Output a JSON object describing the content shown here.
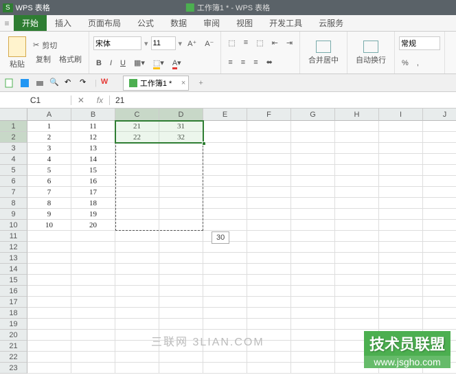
{
  "titlebar": {
    "app": "WPS 表格",
    "doc": "工作簿1 * - WPS 表格"
  },
  "menu": {
    "wps": "W",
    "tabs": [
      "开始",
      "插入",
      "页面布局",
      "公式",
      "数据",
      "审阅",
      "视图",
      "开发工具",
      "云服务"
    ],
    "active": 0
  },
  "ribbon": {
    "paste": "粘贴",
    "cut": "剪切",
    "copy": "复制",
    "format_painter": "格式刷",
    "font_name": "宋体",
    "font_size": "11",
    "bold": "B",
    "italic": "I",
    "underline": "U",
    "merge_center": "合并居中",
    "wrap_text": "自动换行",
    "number_format": "常规",
    "percent": "%",
    "comma": ","
  },
  "qat": {
    "doc_tab": "工作簿1 *"
  },
  "formula_bar": {
    "name_box": "C1",
    "fx": "fx",
    "value": "21"
  },
  "grid": {
    "columns": [
      "A",
      "B",
      "C",
      "D",
      "E",
      "F",
      "G",
      "H",
      "I",
      "J"
    ],
    "sel_cols": [
      2,
      3
    ],
    "sel_rows": [
      0,
      1
    ],
    "row_count": 23,
    "data": [
      [
        "1",
        "11",
        "21",
        "31"
      ],
      [
        "2",
        "12",
        "22",
        "32"
      ],
      [
        "3",
        "13",
        "",
        ""
      ],
      [
        "4",
        "14",
        "",
        ""
      ],
      [
        "5",
        "15",
        "",
        ""
      ],
      [
        "6",
        "16",
        "",
        ""
      ],
      [
        "7",
        "17",
        "",
        ""
      ],
      [
        "8",
        "18",
        "",
        ""
      ],
      [
        "9",
        "19",
        "",
        ""
      ],
      [
        "10",
        "20",
        "",
        ""
      ]
    ],
    "tooltip": "30"
  },
  "watermark": {
    "text1": "三联网  3LIAN.COM",
    "text2a": "技术员联盟",
    "text2b": "www.jsgho.com"
  }
}
